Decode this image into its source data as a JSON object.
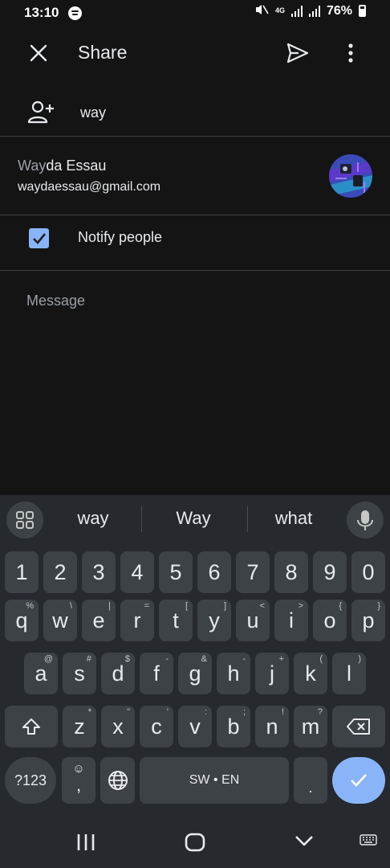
{
  "status_bar": {
    "time": "13:10",
    "network": "4G",
    "battery": "76%"
  },
  "app_bar": {
    "title": "Share",
    "icons": [
      "close-icon",
      "send-icon",
      "more-vert-icon"
    ]
  },
  "recipient": {
    "value": "way",
    "icon": "add-person-icon"
  },
  "suggestion": {
    "name_match": "Way",
    "name_rest": "da Essau",
    "email": "waydaessau@gmail.com"
  },
  "notify": {
    "label": "Notify people",
    "checked": true
  },
  "message": {
    "placeholder": "Message"
  },
  "keyboard": {
    "suggestions": [
      "way",
      "Way",
      "what"
    ],
    "numbers": [
      "1",
      "2",
      "3",
      "4",
      "5",
      "6",
      "7",
      "8",
      "9",
      "0"
    ],
    "row1": [
      {
        "k": "q",
        "h": "%"
      },
      {
        "k": "w",
        "h": "\\"
      },
      {
        "k": "e",
        "h": "|"
      },
      {
        "k": "r",
        "h": "="
      },
      {
        "k": "t",
        "h": "["
      },
      {
        "k": "y",
        "h": "]"
      },
      {
        "k": "u",
        "h": "<"
      },
      {
        "k": "i",
        "h": ">"
      },
      {
        "k": "o",
        "h": "{"
      },
      {
        "k": "p",
        "h": "}"
      }
    ],
    "row2": [
      {
        "k": "a",
        "h": "@"
      },
      {
        "k": "s",
        "h": "#"
      },
      {
        "k": "d",
        "h": "$"
      },
      {
        "k": "f",
        "h": "-"
      },
      {
        "k": "g",
        "h": "&"
      },
      {
        "k": "h",
        "h": "-"
      },
      {
        "k": "j",
        "h": "+"
      },
      {
        "k": "k",
        "h": "("
      },
      {
        "k": "l",
        "h": ")"
      }
    ],
    "row3": [
      {
        "k": "z",
        "h": "*"
      },
      {
        "k": "x",
        "h": "\""
      },
      {
        "k": "c",
        "h": "'"
      },
      {
        "k": "v",
        "h": ":"
      },
      {
        "k": "b",
        "h": ";"
      },
      {
        "k": "n",
        "h": "!"
      },
      {
        "k": "m",
        "h": "?"
      }
    ],
    "symbols_label": "?123",
    "emoji_comma": ",",
    "space_label": "SW • EN",
    "period": ".",
    "accent": "#8ab4f8"
  }
}
